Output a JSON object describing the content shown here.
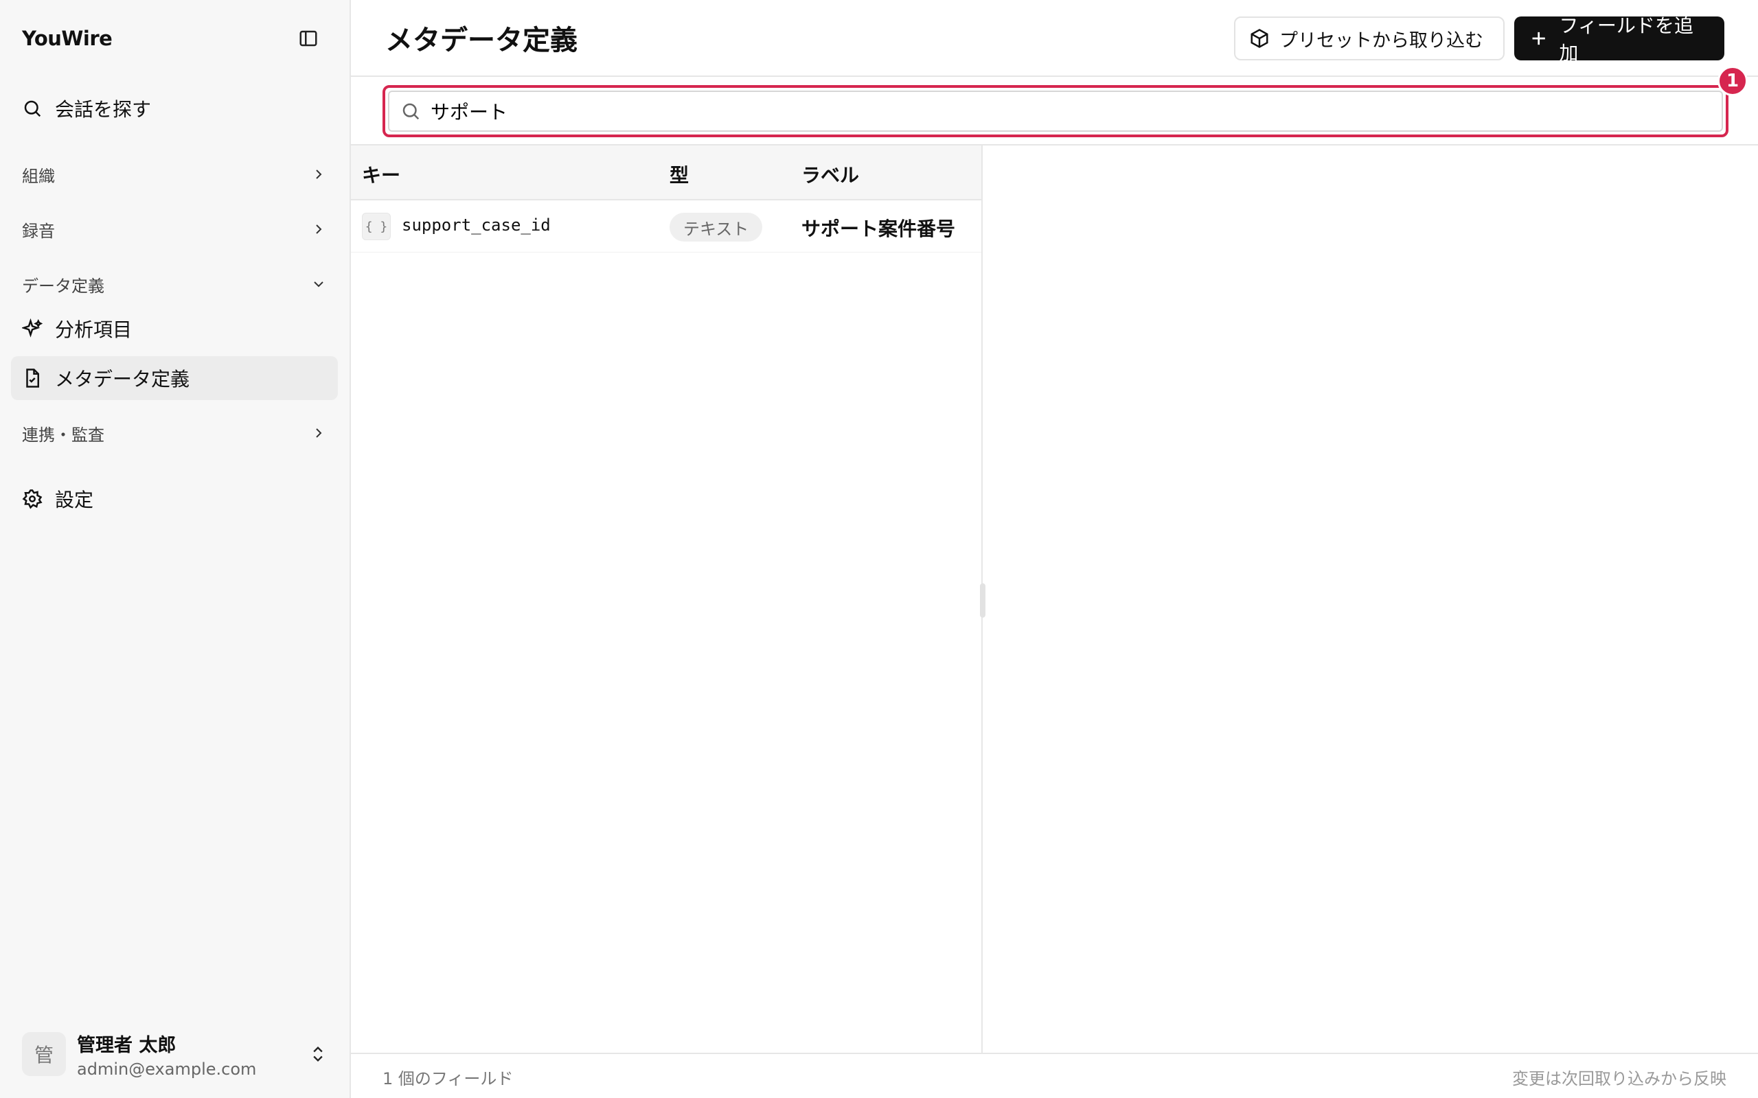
{
  "app": {
    "brand": "YouWire"
  },
  "sidebar": {
    "search_label": "会話を探す",
    "groups": [
      {
        "label": "組織"
      },
      {
        "label": "録音"
      },
      {
        "label": "データ定義"
      },
      {
        "label": "連携・監査"
      }
    ],
    "items": [
      {
        "label": "分析項目",
        "icon": "sparkles-icon"
      },
      {
        "label": "メタデータ定義",
        "icon": "document-icon",
        "active": true
      }
    ],
    "settings_label": "設定",
    "user": {
      "avatar": "管",
      "name": "管理者 太郎",
      "email": "admin@example.com"
    }
  },
  "header": {
    "title": "メタデータ定義",
    "import_button": "プリセットから取り込む",
    "add_button": "フィールドを追加"
  },
  "search": {
    "value": "サポート",
    "badge": "1"
  },
  "table": {
    "columns": [
      "キー",
      "型",
      "ラベル"
    ],
    "rows": [
      {
        "icon": "{ }",
        "key": "support_case_id",
        "type": "テキスト",
        "label": "サポート案件番号"
      }
    ]
  },
  "footer": {
    "count": "1 個のフィールド",
    "note": "変更は次回取り込みから反映"
  },
  "colors": {
    "accent": "#d6264f",
    "dark_button": "#111111",
    "sidebar_bg": "#f7f7f7"
  }
}
